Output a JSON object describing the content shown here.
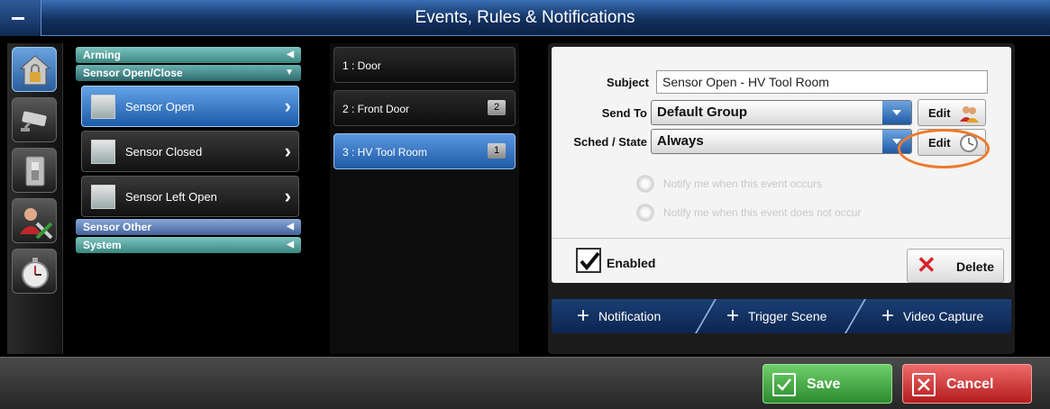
{
  "window": {
    "title": "Events, Rules & Notifications"
  },
  "nav_icons": [
    {
      "name": "home-lock-icon",
      "active": true
    },
    {
      "name": "security-camera-icon",
      "active": false
    },
    {
      "name": "light-switch-icon",
      "active": false
    },
    {
      "name": "user-tools-icon",
      "active": false
    },
    {
      "name": "stopwatch-icon",
      "active": false
    }
  ],
  "categories": {
    "arming": "Arming",
    "sensor_open_close": "Sensor Open/Close",
    "sensor_other": "Sensor Other",
    "system": "System",
    "sub_items": [
      {
        "label": "Sensor Open",
        "active": true
      },
      {
        "label": "Sensor Closed",
        "active": false
      },
      {
        "label": "Sensor Left Open",
        "active": false
      }
    ]
  },
  "events": [
    {
      "label": "1 : Door",
      "badge": ""
    },
    {
      "label": "2 : Front Door",
      "badge": "2"
    },
    {
      "label": "3 : HV Tool Room",
      "badge": "1"
    }
  ],
  "detail": {
    "subject_label": "Subject",
    "subject_value": "Sensor Open - HV Tool Room",
    "send_to_label": "Send To",
    "send_to_value": "Default Group",
    "sched_label": "Sched / State",
    "sched_value": "Always",
    "edit_label": "Edit",
    "radio_occurs": "Notify me when this event occurs",
    "radio_not_occur": "Notify me when this event does not occur",
    "enabled_label": "Enabled",
    "enabled_checked": true,
    "delete_label": "Delete"
  },
  "tabs": [
    {
      "label": "Notification"
    },
    {
      "label": "Trigger Scene"
    },
    {
      "label": "Video Capture"
    }
  ],
  "bottom": {
    "save_label": "Save",
    "cancel_label": "Cancel"
  },
  "colors": {
    "highlight_ring": "#ee7a2c",
    "save": "#3aa23a",
    "cancel": "#c82828",
    "accent": "#1f59a4"
  }
}
